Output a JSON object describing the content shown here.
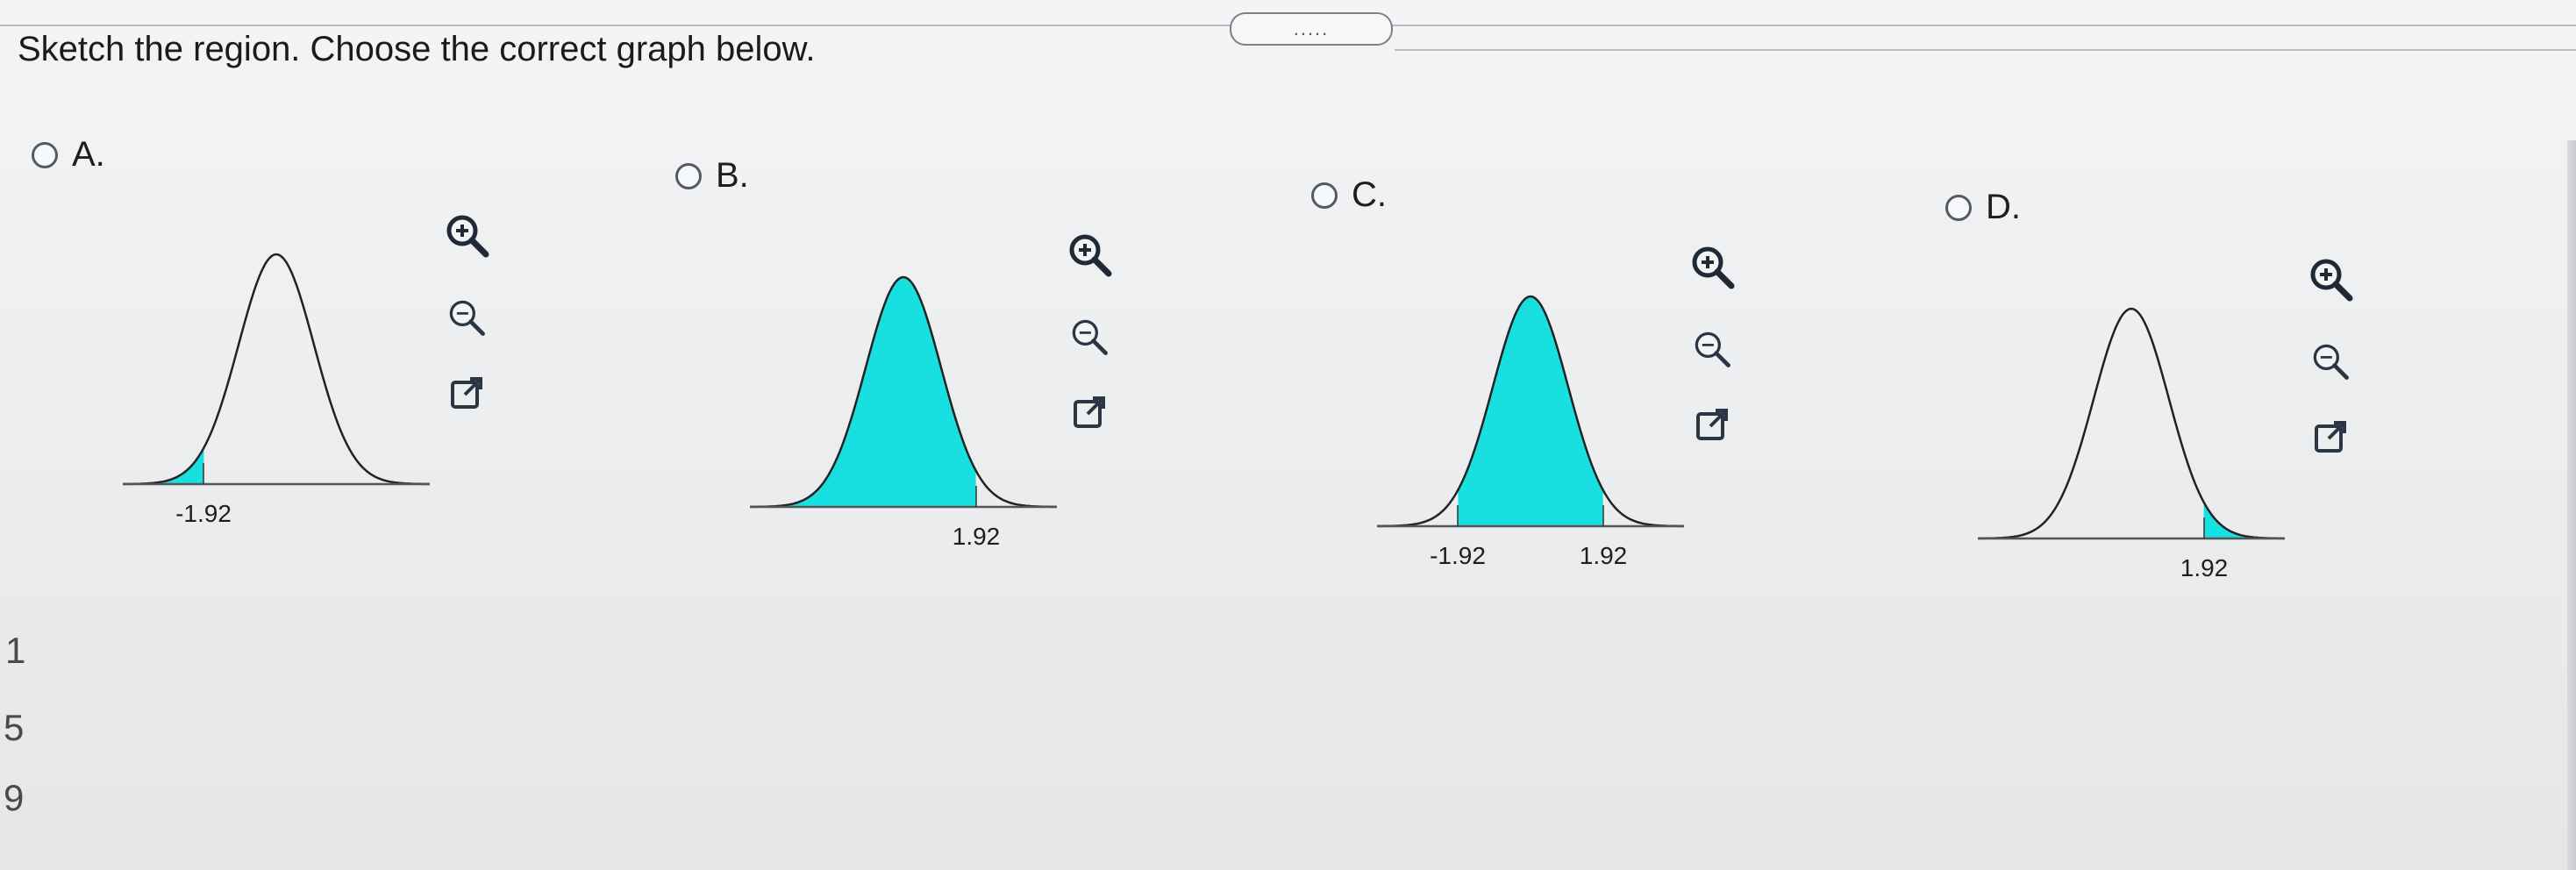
{
  "question": {
    "prompt": "Sketch the region. Choose the correct graph below."
  },
  "toolbar": {
    "more_label": "....."
  },
  "colors": {
    "shade": "#19e0e0",
    "curve": "#222222",
    "radio_border": "#555a60"
  },
  "options": [
    {
      "letter": "A.",
      "shade": "left-tail",
      "labels": [
        "-1.92"
      ]
    },
    {
      "letter": "B.",
      "shade": "left-of",
      "labels": [
        "1.92"
      ]
    },
    {
      "letter": "C.",
      "shade": "between",
      "labels": [
        "-1.92",
        "1.92"
      ]
    },
    {
      "letter": "D.",
      "shade": "right-tail",
      "labels": [
        "1.92"
      ]
    }
  ],
  "icons": {
    "zoom_in": "zoom-in-icon",
    "zoom_out": "zoom-out-icon",
    "popout": "external-link-icon"
  },
  "edge_numbers": [
    "1",
    "5",
    "9"
  ]
}
